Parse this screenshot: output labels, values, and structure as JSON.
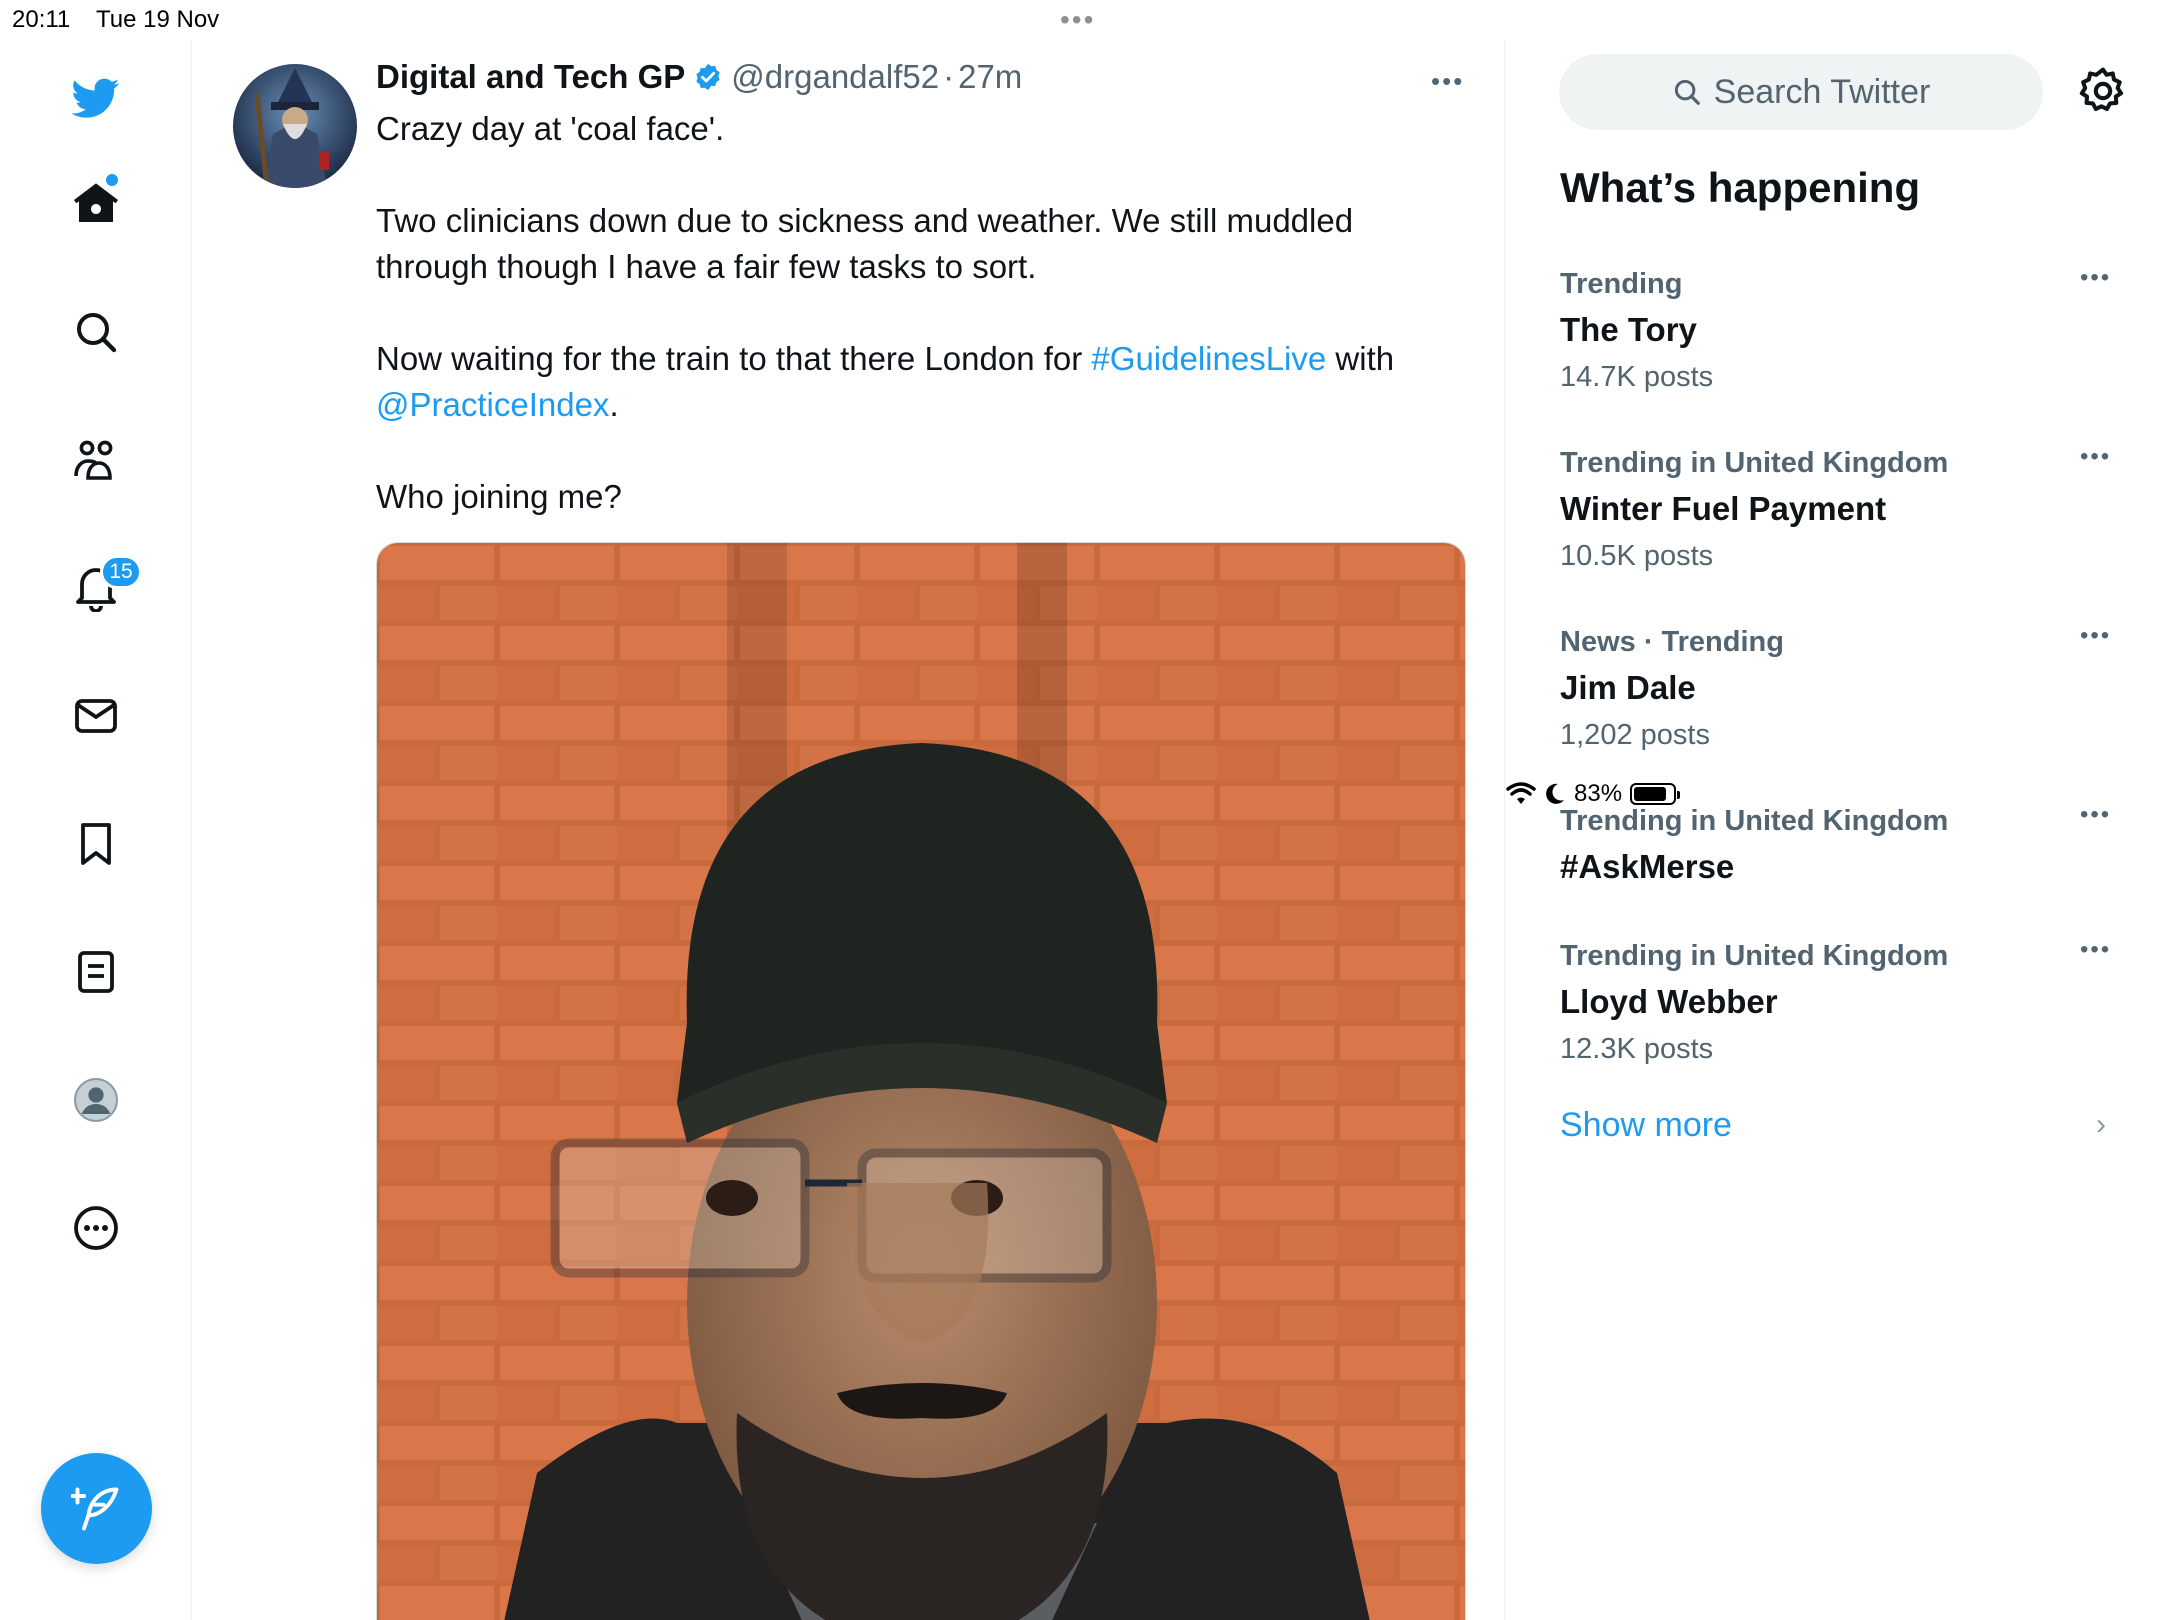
{
  "status_bar": {
    "time": "20:11",
    "date": "Tue 19 Nov",
    "battery": "83%",
    "battery_level": 0.83
  },
  "nav": {
    "notifications_badge": "15",
    "icons": [
      "twitter-logo-icon",
      "home-icon",
      "search-icon",
      "communities-icon",
      "notifications-icon",
      "messages-icon",
      "bookmarks-icon",
      "lists-icon",
      "profile-icon",
      "more-icon",
      "compose-icon"
    ]
  },
  "tweet": {
    "name": "Digital and Tech GP",
    "handle": "@drgandalf52",
    "separator": "·",
    "ago": "27m",
    "line1": "Crazy day at 'coal face'.",
    "line2": "Two clinicians down due to sickness and weather. We still muddled through though I have a fair few tasks to sort.",
    "line3_pre": "Now waiting for the train to that there London for ",
    "hashtag": "#GuidelinesLive",
    "line3_mid": " with ",
    "mention": "@PracticeIndex",
    "line3_post": ".",
    "line4": "Who joining me?"
  },
  "sidebar": {
    "search_placeholder": "Search Twitter",
    "section_title": "What’s happening",
    "trends": [
      {
        "context": "Trending",
        "topic": "The Tory",
        "count": "14.7K posts"
      },
      {
        "context": "Trending in United Kingdom",
        "topic": "Winter Fuel Payment",
        "count": "10.5K posts"
      },
      {
        "context": "News · Trending",
        "topic": "Jim Dale",
        "count": "1,202 posts"
      },
      {
        "context": "Trending in United Kingdom",
        "topic": "#AskMerse",
        "count": ""
      },
      {
        "context": "Trending in United Kingdom",
        "topic": "Lloyd Webber",
        "count": "12.3K posts"
      }
    ],
    "show_more": "Show more"
  },
  "colors": {
    "accent": "#1d9bf0",
    "text_primary": "#0f1419",
    "text_secondary": "#536471",
    "search_bg": "#eff3f4"
  }
}
